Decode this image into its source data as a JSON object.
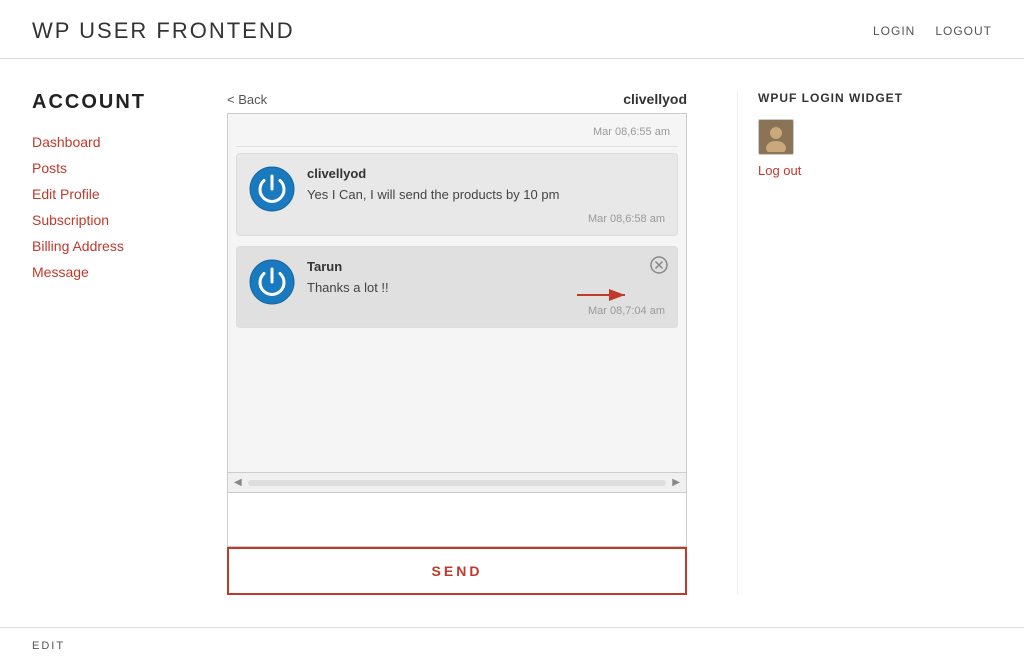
{
  "site": {
    "title": "WP USER FRONTEND"
  },
  "header_nav": {
    "login_label": "LOGIN",
    "logout_label": "LOGOUT"
  },
  "sidebar": {
    "section_title": "ACCOUNT",
    "nav_items": [
      {
        "label": "Dashboard",
        "id": "dashboard"
      },
      {
        "label": "Posts",
        "id": "posts"
      },
      {
        "label": "Edit Profile",
        "id": "edit-profile"
      },
      {
        "label": "Subscription",
        "id": "subscription"
      },
      {
        "label": "Billing Address",
        "id": "billing-address"
      },
      {
        "label": "Message",
        "id": "message"
      }
    ]
  },
  "chat": {
    "back_label": "< Back",
    "recipient_name": "clivellyod",
    "messages": [
      {
        "id": 1,
        "sender": "clivellyod",
        "text": "Yes I Can, I will send the products by 10 pm",
        "timestamp": "Mar 08,6:58 am",
        "show_close": false
      },
      {
        "id": 2,
        "sender": "Tarun",
        "text": "Thanks a lot !!",
        "timestamp": "Mar 08,7:04 am",
        "show_close": true
      }
    ],
    "timestamp_top": "Mar 08,6:55 am",
    "send_button_label": "SEND",
    "input_placeholder": ""
  },
  "widget": {
    "title": "WPUF LOGIN WIDGET",
    "logout_label": "Log out"
  },
  "footer": {
    "edit_label": "EDIT"
  },
  "colors": {
    "accent": "#c0392b",
    "link": "#c0392b"
  }
}
